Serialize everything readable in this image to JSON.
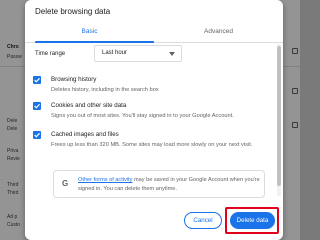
{
  "background": {
    "items": [
      {
        "label": "Chro",
        "bold": true
      },
      {
        "label": "Passw",
        "bold": false
      },
      {
        "label": "Dele",
        "bold": false
      },
      {
        "label": "Dele",
        "bold": false
      },
      {
        "label": "Priva",
        "bold": false
      },
      {
        "label": "Revie",
        "bold": false
      },
      {
        "label": "Third",
        "bold": false
      },
      {
        "label": "Third",
        "bold": false
      },
      {
        "label": "Ad p",
        "bold": false
      },
      {
        "label": "Custo",
        "bold": false
      }
    ]
  },
  "dialog": {
    "title": "Delete browsing data",
    "tabs": [
      {
        "label": "Basic",
        "active": true
      },
      {
        "label": "Advanced",
        "active": false
      }
    ],
    "time_range": {
      "label": "Time range",
      "value": "Last hour"
    },
    "options": [
      {
        "title": "Browsing history",
        "description": "Deletes history, including in the search box",
        "checked": true
      },
      {
        "title": "Cookies and other site data",
        "description": "Signs you out of most sites. You'll stay signed in to your Google Account.",
        "checked": true
      },
      {
        "title": "Cached images and files",
        "description": "Frees up less than 320 MB. Some sites may load more slowly on your next visit.",
        "checked": true
      }
    ],
    "info": {
      "icon": "google-g-icon",
      "link_text": "Other forms of activity",
      "text": " may be saved in your Google Account when you're signed in. You can delete them anytime."
    },
    "buttons": {
      "cancel": "Cancel",
      "delete": "Delete data"
    }
  },
  "colors": {
    "accent": "#1a73e8",
    "highlight": "#e3001b"
  }
}
